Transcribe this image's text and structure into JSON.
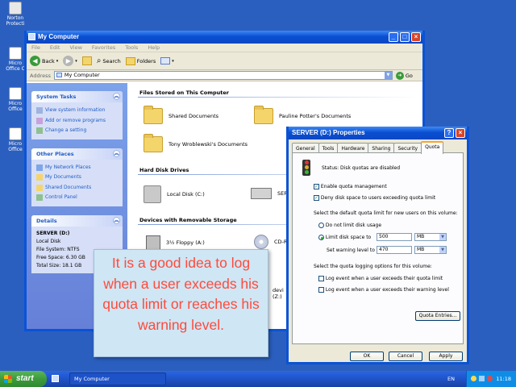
{
  "desktop": {
    "icons": [
      {
        "label": "Norton Protecti"
      },
      {
        "label": "Micro Office C"
      },
      {
        "label": "Micro Office"
      },
      {
        "label": "Micro Office"
      }
    ]
  },
  "window": {
    "title": "My Computer",
    "menu": [
      "File",
      "Edit",
      "View",
      "Favorites",
      "Tools",
      "Help"
    ],
    "toolbar": {
      "back": "Back",
      "search": "Search",
      "folders": "Folders"
    },
    "address": {
      "label": "Address",
      "value": "My Computer",
      "go": "Go"
    }
  },
  "left_pane": {
    "system_tasks": {
      "title": "System Tasks",
      "items": [
        "View system information",
        "Add or remove programs",
        "Change a setting"
      ]
    },
    "other_places": {
      "title": "Other Places",
      "items": [
        "My Network Places",
        "My Documents",
        "Shared Documents",
        "Control Panel"
      ]
    },
    "details": {
      "title": "Details",
      "name": "SERVER (D:)",
      "type": "Local Disk",
      "file_system": "File System: NTFS",
      "free_space": "Free Space: 6.30 GB",
      "total_size": "Total Size: 18.1 GB"
    }
  },
  "content": {
    "files_stored": {
      "title": "Files Stored on This Computer",
      "items": [
        "Shared Documents",
        "Pauline Potter's Documents",
        "Tony Wroblewski's Documents"
      ]
    },
    "hard_disk": {
      "title": "Hard Disk Drives",
      "items": [
        "Local Disk (C:)",
        "SERV"
      ]
    },
    "removable": {
      "title": "Devices with Removable Storage",
      "items": [
        "3½ Floppy (A:)",
        "CD-R",
        "devi (Z:)"
      ]
    }
  },
  "dialog": {
    "title": "SERVER (D:) Properties",
    "tabs": [
      "General",
      "Tools",
      "Hardware",
      "Sharing",
      "Security",
      "Quota"
    ],
    "active_tab": "Quota",
    "status": "Status:  Disk quotas are disabled",
    "enable_quota": "Enable quota management",
    "deny_space": "Deny disk space to users exceeding quota limit",
    "default_limit_label": "Select the default quota limit for new users on this volume:",
    "no_limit": "Do not limit disk usage",
    "limit_to": "Limit disk space to",
    "limit_value": "500",
    "limit_unit": "MB",
    "warning_label": "Set warning level to",
    "warning_value": "470",
    "warning_unit": "MB",
    "logging_label": "Select the quota logging options for this volume:",
    "log_quota": "Log event when a user exceeds their quota limit",
    "log_warning": "Log event when a user exceeds their warning level",
    "quota_entries": "Quota Entries...",
    "ok": "OK",
    "cancel": "Cancel",
    "apply": "Apply"
  },
  "caption": {
    "text": "It is a good idea to log when a user exceeds his quota limit or reaches his warning level."
  },
  "taskbar": {
    "start": "start",
    "task": "My Computer",
    "lang": "EN",
    "time": "11:18"
  },
  "colors": {
    "desktop": "#2b5fbf",
    "titlebar": "#0a4fd3",
    "caption_text": "#ff4a3a",
    "caption_bg": "#cfe6f5"
  }
}
